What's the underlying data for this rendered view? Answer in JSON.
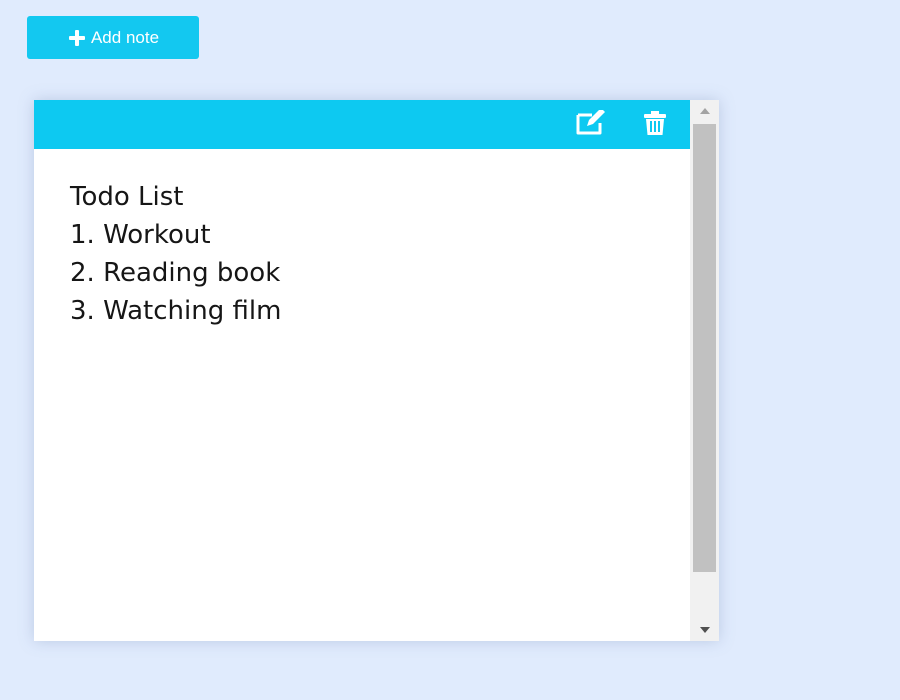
{
  "toolbar": {
    "add_note_label": "Add note",
    "add_icon": "plus-icon"
  },
  "note": {
    "edit_icon": "edit-icon",
    "delete_icon": "trash-icon",
    "lines": [
      "Todo List",
      "1. Workout",
      "2. Reading book",
      "3. Watching film"
    ]
  },
  "colors": {
    "page_background": "#e0ebfd",
    "accent": "#0dc9f1",
    "button": "#13c8f0",
    "text": "#161616"
  }
}
